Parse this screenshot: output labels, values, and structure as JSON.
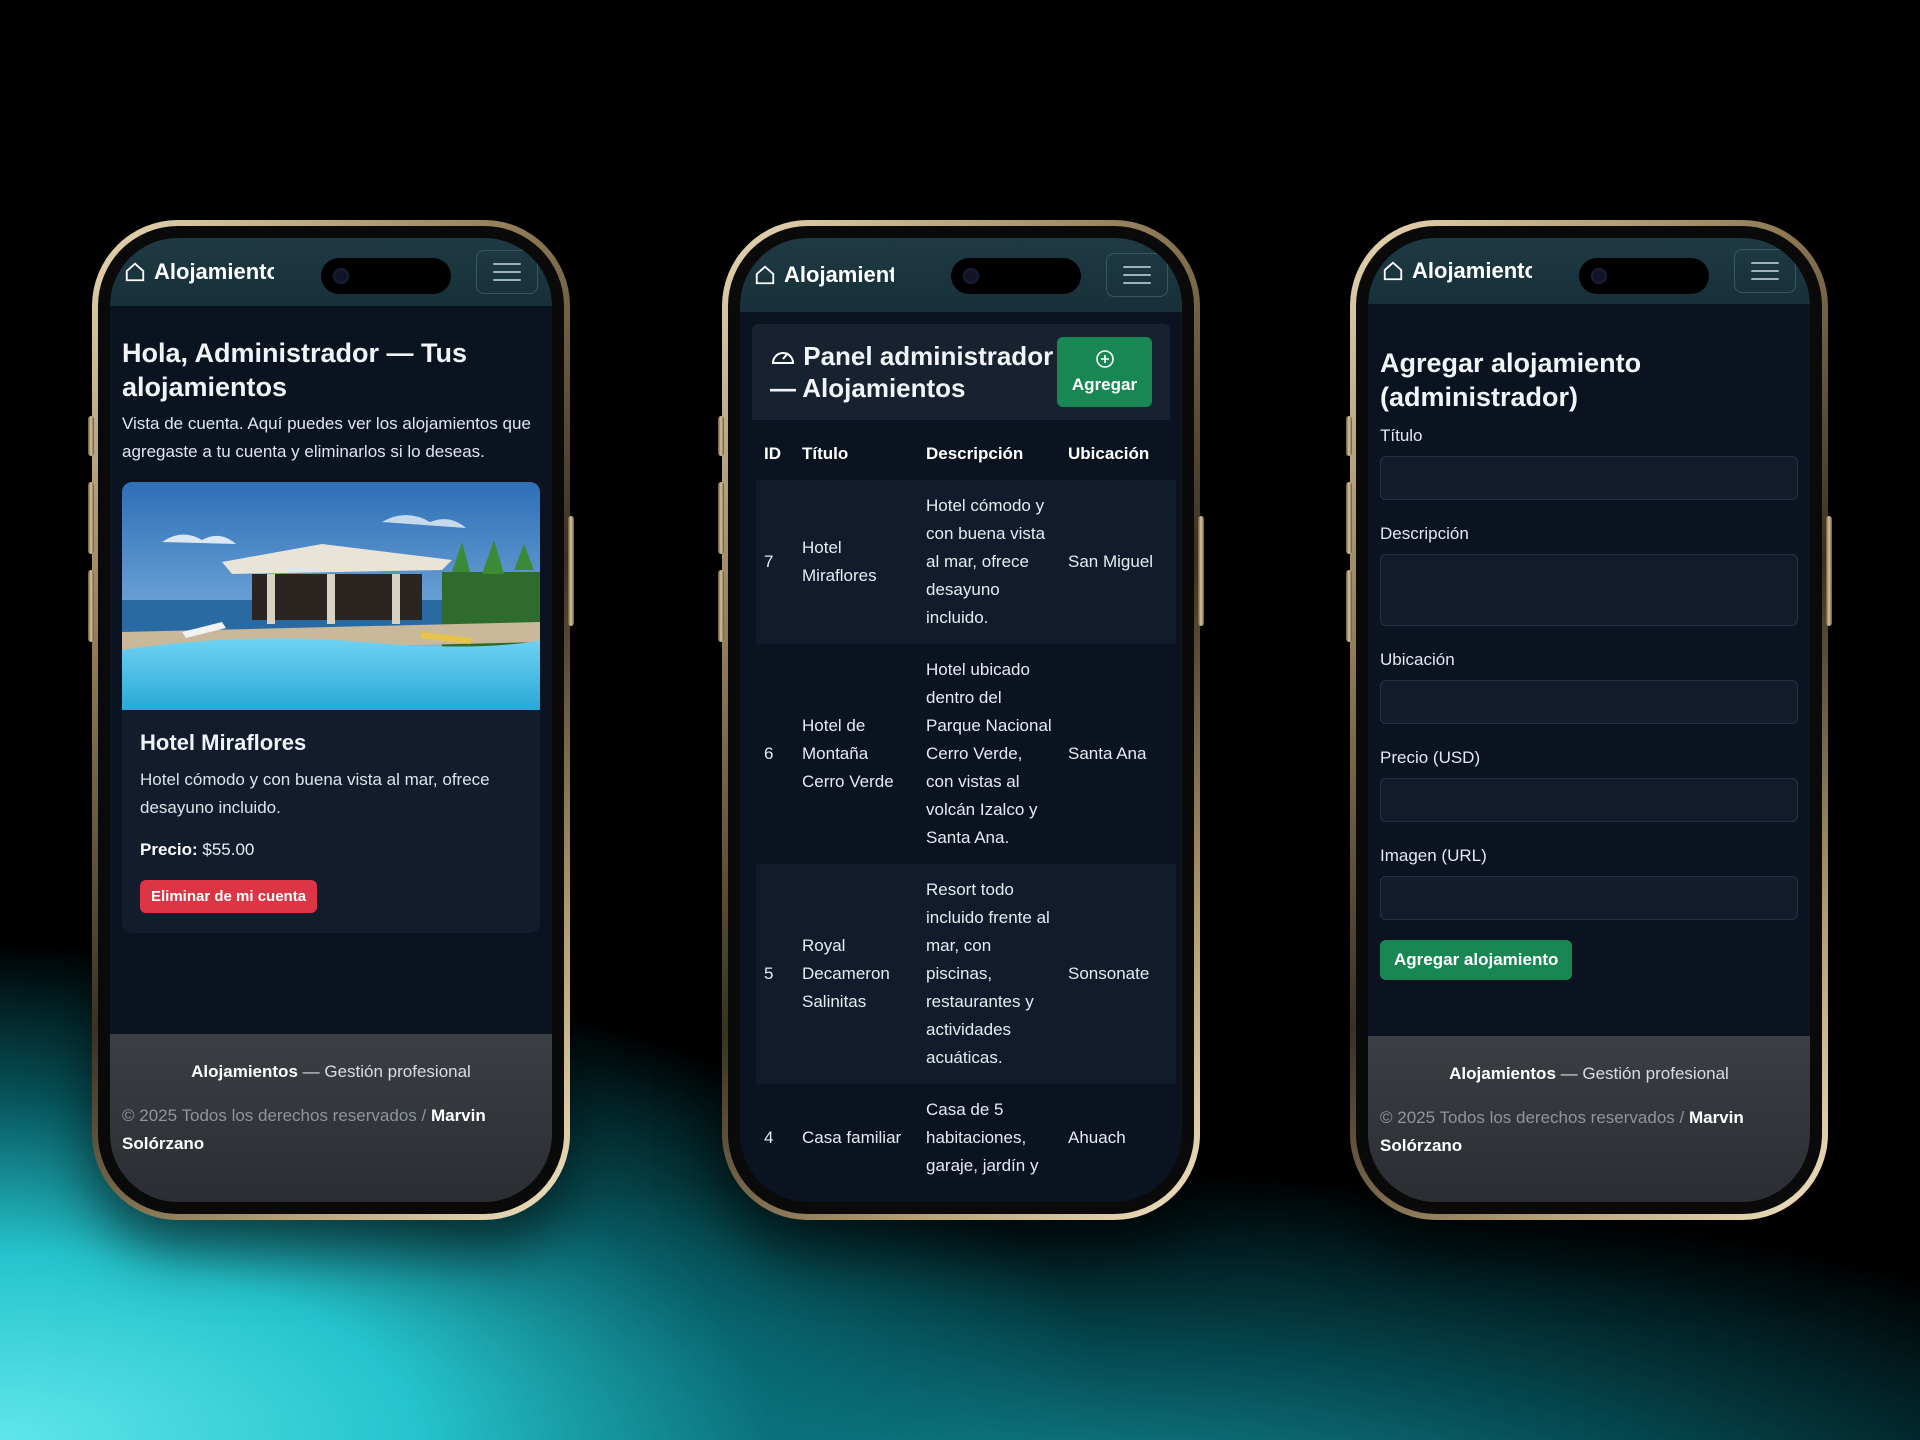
{
  "brand": "Alojamientos",
  "colors": {
    "accent_green": "#198754",
    "danger_red": "#dc3545",
    "navbar": "#1f3a44",
    "background": "#0b1220"
  },
  "phone1": {
    "title": "Hola, Administrador — Tus alojamientos",
    "lead": "Vista de cuenta. Aquí puedes ver los alojamientos que agregaste a tu cuenta y eliminarlos si lo deseas.",
    "card": {
      "title": "Hotel Miraflores",
      "text": "Hotel cómodo y con buena vista al mar, ofrece desayuno incluido.",
      "price_label": "Precio:",
      "price_value": "$55.00",
      "delete_label": "Eliminar de mi cuenta"
    }
  },
  "phone2": {
    "panel_title": "Panel administrador — Alojamientos",
    "add_label": "Agregar",
    "table": {
      "headers": [
        "ID",
        "Título",
        "Descripción",
        "Ubicación"
      ],
      "rows": [
        {
          "id": "7",
          "titulo": "Hotel Miraflores",
          "descripcion": "Hotel cómodo y con buena vista al mar, ofrece desayuno incluido.",
          "ubicacion": "San Miguel"
        },
        {
          "id": "6",
          "titulo": "Hotel de Montaña Cerro Verde",
          "descripcion": "Hotel ubicado dentro del Parque Nacional Cerro Verde, con vistas al volcán Izalco y Santa Ana.",
          "ubicacion": "Santa Ana"
        },
        {
          "id": "5",
          "titulo": "Royal Decameron Salinitas",
          "descripcion": "Resort todo incluido frente al mar, con piscinas, restaurantes y actividades acuáticas.",
          "ubicacion": "Sonsonate"
        },
        {
          "id": "4",
          "titulo": "Casa familiar",
          "descripcion": "Casa de 5 habitaciones, garaje, jardín y",
          "ubicacion": "Ahuach"
        }
      ]
    }
  },
  "phone3": {
    "title": "Agregar alojamiento (administrador)",
    "labels": {
      "titulo": "Título",
      "descripcion": "Descripción",
      "ubicacion": "Ubicación",
      "precio": "Precio (USD)",
      "imagen": "Imagen (URL)"
    },
    "submit_label": "Agregar alojamiento"
  },
  "footer": {
    "brand": "Alojamientos",
    "tagline": " — Gestión profesional",
    "copyright": "© 2025 Todos los derechos reservados / ",
    "author": "Marvin Solórzano"
  },
  "icons": {
    "brand": "house-icon",
    "menu": "hamburger-icon",
    "panel": "speedometer-icon",
    "add": "plus-circle-icon"
  }
}
